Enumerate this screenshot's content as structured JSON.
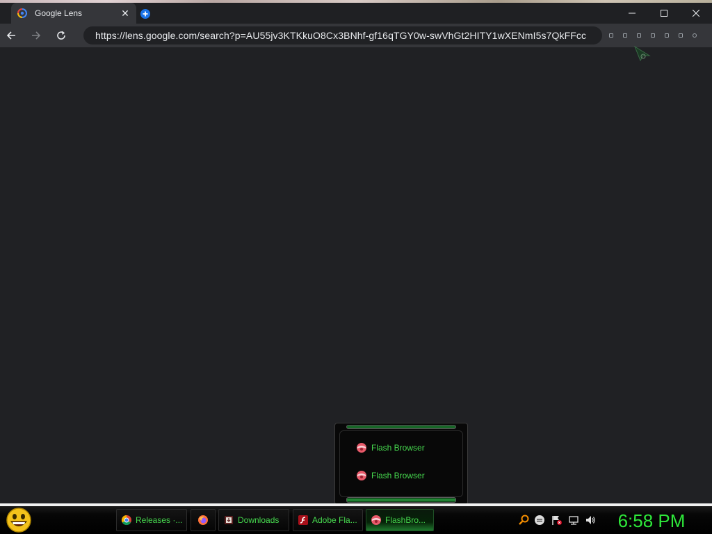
{
  "browser": {
    "tab": {
      "title": "Google Lens",
      "favicon": "google-lens-icon",
      "close_glyph": "✕"
    },
    "new_tab_icon": "new-tab-plus-icon",
    "window_controls": [
      "minimize-icon",
      "maximize-icon",
      "close-icon"
    ],
    "nav": {
      "back_icon": "back-arrow-icon",
      "forward_icon": "forward-arrow-icon",
      "reload_icon": "reload-icon"
    },
    "address_bar": {
      "url": "https://lens.google.com/search?p=AU55jv3KTKkuO8Cx3BNhf-gf16qTGY0w-swVhGt2HITY1wXENmI5s7QkFFcc"
    },
    "extension_icon_count": 7
  },
  "popup_menu": {
    "items": [
      {
        "label": "Flash Browser",
        "icon": "flash-browser-icon"
      },
      {
        "label": "Flash Browser",
        "icon": "flash-browser-icon"
      }
    ]
  },
  "taskbar": {
    "start_icon": "smiley-start-icon",
    "buttons": [
      {
        "label": "Releases ·...",
        "icon": "chrome-icon",
        "active": false
      },
      {
        "label": "",
        "icon": "firefox-icon",
        "active": false
      },
      {
        "label": "Downloads",
        "icon": "downloads-folder-icon",
        "active": false
      },
      {
        "label": "Adobe Fla...",
        "icon": "adobe-flash-icon",
        "active": false
      },
      {
        "label": "FlashBro...",
        "icon": "flash-browser-icon",
        "active": true
      }
    ],
    "tray_icons": [
      "search-icon",
      "messenger-icon",
      "action-center-flag-icon",
      "network-icon",
      "volume-icon"
    ],
    "clock": "6:58 PM"
  },
  "colors": {
    "accent_green": "#46d94e",
    "clock_green": "#2ee83a",
    "browser_dark": "#202124",
    "toolbar": "#35363a"
  }
}
